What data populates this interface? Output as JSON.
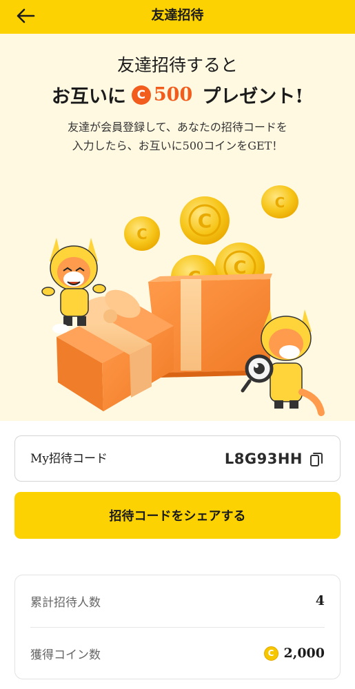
{
  "header": {
    "title": "友達招待",
    "back_icon": "arrow-left-icon"
  },
  "hero": {
    "line1": "友達招待すると",
    "line2_prefix": "お互いに",
    "coin_symbol": "C",
    "amount": "500",
    "line2_suffix": "プレゼント!",
    "desc_line1": "友達が会員登録して、あなたの招待コードを",
    "desc_line2": "入力したら、お互いに500コインをGET！"
  },
  "invite_code": {
    "label": "My招待コード",
    "value": "L8G93HH",
    "copy_icon": "copy-icon"
  },
  "share_button": {
    "label": "招待コードをシェアする"
  },
  "stats": {
    "invited_label": "累計招待人数",
    "invited_value": "4",
    "coins_label": "獲得コイン数",
    "coin_symbol": "C",
    "coins_value": "2,000"
  },
  "colors": {
    "brand_yellow": "#fcd202",
    "hero_bg": "#fff9e2",
    "accent_orange": "#f25c1c"
  }
}
